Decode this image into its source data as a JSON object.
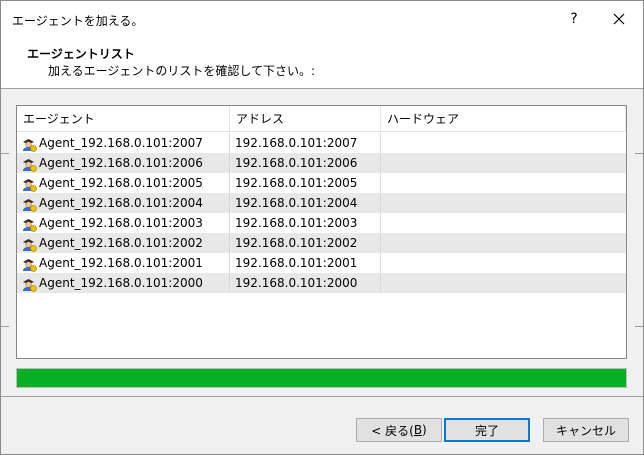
{
  "window": {
    "title": "エージェントを加える。",
    "help_glyph": "?",
    "close_glyph": "✕"
  },
  "header": {
    "title": "エージェントリスト",
    "subtitle": "加えるエージェントのリストを確認して下さい。:"
  },
  "list": {
    "columns": [
      "エージェント",
      "アドレス",
      "ハードウェア"
    ],
    "rows": [
      {
        "agent": "Agent_192.168.0.101:2007",
        "address": "192.168.0.101:2007",
        "hardware": ""
      },
      {
        "agent": "Agent_192.168.0.101:2006",
        "address": "192.168.0.101:2006",
        "hardware": ""
      },
      {
        "agent": "Agent_192.168.0.101:2005",
        "address": "192.168.0.101:2005",
        "hardware": ""
      },
      {
        "agent": "Agent_192.168.0.101:2004",
        "address": "192.168.0.101:2004",
        "hardware": ""
      },
      {
        "agent": "Agent_192.168.0.101:2003",
        "address": "192.168.0.101:2003",
        "hardware": ""
      },
      {
        "agent": "Agent_192.168.0.101:2002",
        "address": "192.168.0.101:2002",
        "hardware": ""
      },
      {
        "agent": "Agent_192.168.0.101:2001",
        "address": "192.168.0.101:2001",
        "hardware": ""
      },
      {
        "agent": "Agent_192.168.0.101:2000",
        "address": "192.168.0.101:2000",
        "hardware": ""
      }
    ],
    "row_icon": "agent-user-icon"
  },
  "progress": {
    "value_percent": 100,
    "color": "#06b025"
  },
  "buttons": {
    "back_label": "< 戻る(",
    "back_mnemonic": "B",
    "back_close": ")",
    "finish_label": "完了",
    "cancel_label": "キャンセル"
  },
  "colors": {
    "accent": "#0078d7",
    "row_alt": "#e8e8e8"
  }
}
